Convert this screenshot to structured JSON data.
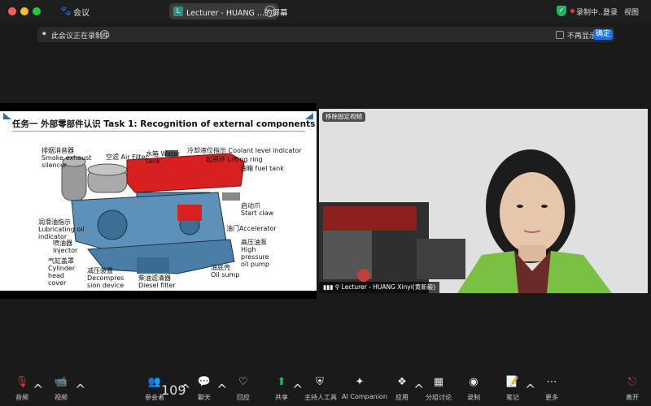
{
  "window": {
    "app_label": "会议",
    "title": "Lecturer - HUANG ...的屏幕",
    "recording_status": "录制中...",
    "login_label": "登录",
    "view_label": "视图",
    "app_icon": "paw-icon",
    "security_color": "#21b463",
    "record_color": "#e23a3a"
  },
  "banner": {
    "text": "此会议正在录制中",
    "dont_show_label": "不再显示",
    "confirm_label": "确定",
    "confirm_color": "#1f6fe5"
  },
  "slide": {
    "title": "任务一  外部零部件认识 Task 1: Recognition of external components",
    "labels": {
      "exhaust": "排烟消音器",
      "exhaust_en": "Smoke exhaust",
      "exhaust_en2": "silencer",
      "air_filter": "空滤 Air Filter",
      "water_tank": "水箱 Water",
      "water_tank2": "tank",
      "coolant": "冷却液位指示 Coolant level indicator",
      "lifting": "起吊环 Lifting ring",
      "fuel_tank": "油箱 fuel tank",
      "start_claw": "启动爪",
      "start_claw_en": "Start claw",
      "accelerator": "油门Accelerator",
      "lub_ind": "润滑油指示",
      "lub_ind_en": "Lubricating oil",
      "lub_ind_en2": "indicator",
      "injector": "喷油器",
      "injector_en": "Injector",
      "head_cover": "气缸盖罩",
      "head_cover_en": "Cylinder",
      "head_cover_en2": "head",
      "head_cover_en3": "cover",
      "decomp": "减压装置",
      "decomp_en": "Decompres",
      "decomp_en2": "sion device",
      "diesel_filter": "柴油滤清器",
      "diesel_filter_en": "Diesel filter",
      "hp_pump": "高压油泵",
      "hp_pump_en": "High",
      "hp_pump_en2": "pressure",
      "hp_pump_en3": "oil pump",
      "oil_sump": "油底壳",
      "oil_sump_en": "Oil sump"
    }
  },
  "video": {
    "pin_label": "移除固定视频",
    "participant_name": "Lecturer - HUANG Xinyi(黄新毅)"
  },
  "toolbar": {
    "audio": "音频",
    "video": "视频",
    "participants": "参会者",
    "participant_count": "109",
    "chat": "聊天",
    "reactions": "回应",
    "share": "共享",
    "host_tools": "主持人工具",
    "ai_companion": "AI Companion",
    "apps": "应用",
    "breakout": "分组讨论",
    "record": "录制",
    "notes": "笔记",
    "more": "更多",
    "leave": "离开",
    "share_color": "#21c063",
    "leave_color": "#e23a3a"
  }
}
